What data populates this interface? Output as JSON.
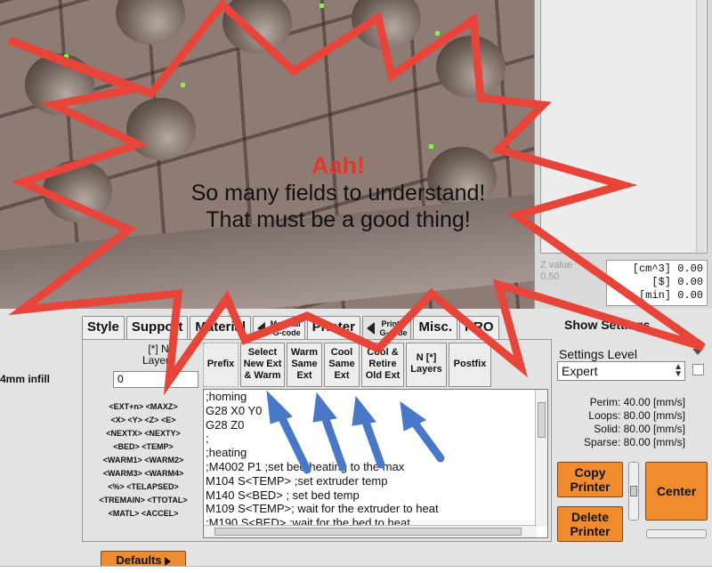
{
  "annotation": {
    "title": "Aah!",
    "line1": "So many fields to understand!",
    "line2": "That must be a good thing!"
  },
  "colors": {
    "orange": "#f08c2e",
    "burst": "#e8453a",
    "arrow": "#4a78c8"
  },
  "stats": [
    {
      "unit": "[cm^3]",
      "value": "0.00"
    },
    {
      "unit": "[$]",
      "value": "0.00"
    },
    {
      "unit": "[min]",
      "value": "0.00"
    }
  ],
  "zvalue": {
    "label": "Z value",
    "value": "0.50"
  },
  "tabs": [
    {
      "label": "Style"
    },
    {
      "label": "Support"
    },
    {
      "label": "Material"
    },
    {
      "line1": "Material",
      "line2": "G-code"
    },
    {
      "label": "Printer"
    },
    {
      "line1": "Printer",
      "line2": "G-code"
    },
    {
      "label": "Misc."
    },
    {
      "label": "PRO"
    }
  ],
  "show_settings": "Show Settings",
  "infill_label": "4mm infill",
  "nlayers": {
    "line1": "[*] N",
    "line2": "Layers",
    "value": "0"
  },
  "variables": [
    "<EXT+n> <MAXZ>",
    "<X> <Y> <Z> <E>",
    "<NEXTX> <NEXTY>",
    "<BED> <TEMP>",
    "<WARM1> <WARM2>",
    "<WARM3> <WARM4>",
    "<%> <TELAPSED>",
    "<TREMAIN> <TTOTAL>",
    "<MATL> <ACCEL>"
  ],
  "defaults_label": "Defaults",
  "gcode_buttons": [
    {
      "lines": [
        "Prefix"
      ]
    },
    {
      "lines": [
        "Select",
        "New Ext",
        "& Warm"
      ]
    },
    {
      "lines": [
        "Warm",
        "Same",
        "Ext"
      ]
    },
    {
      "lines": [
        "Cool",
        "Same",
        "Ext"
      ]
    },
    {
      "lines": [
        "Cool &",
        "Retire",
        "Old Ext"
      ]
    },
    {
      "lines": [
        "N [*]",
        "Layers"
      ]
    },
    {
      "lines": [
        "Postfix"
      ]
    }
  ],
  "code_lines": [
    ";homing",
    "G28 X0 Y0",
    "G28 Z0",
    ";",
    ";heating",
    ";M4002 P1 ;set bed heating to the max",
    "M104 S<TEMP> ;set extruder temp",
    "M140 S<BED> ; set bed temp",
    "M109 S<TEMP>; wait for the extruder to heat",
    ";M190 S<BED> ;wait for the bed to heat"
  ],
  "settings_level_label": "Settings Level",
  "settings_level_value": "Expert",
  "speeds": [
    "Perim:  40.00 [mm/s]",
    "Loops:  80.00 [mm/s]",
    "Solid:  80.00 [mm/s]",
    "Sparse: 80.00 [mm/s]"
  ],
  "buttons": {
    "copy_line1": "Copy",
    "copy_line2": "Printer",
    "delete_line1": "Delete",
    "delete_line2": "Printer",
    "center": "Center"
  }
}
